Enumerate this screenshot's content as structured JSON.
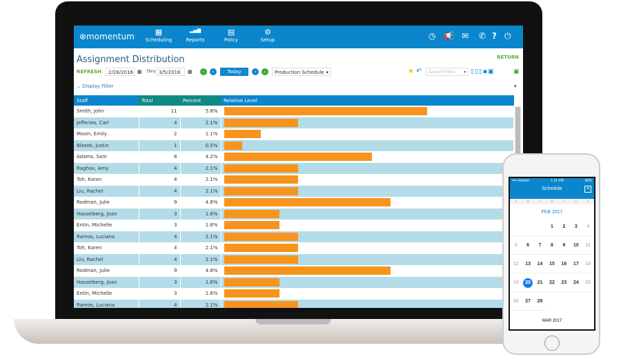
{
  "app": {
    "logo": "⊗momentum",
    "nav": [
      {
        "label": "Scheduling",
        "icon": "▦"
      },
      {
        "label": "Reports",
        "icon": "▂▄▆"
      },
      {
        "label": "Policy",
        "icon": "▤"
      },
      {
        "label": "Setup",
        "icon": "⚙"
      }
    ],
    "right_icons": [
      "clock-icon",
      "megaphone-icon",
      "mail-icon",
      "phone-icon",
      "help-icon",
      "power-icon"
    ]
  },
  "page": {
    "title": "Assignment Distribution",
    "return": "RETURN",
    "refresh": "REFRESH",
    "from": "2/28/2016",
    "thru": "thru",
    "to": "3/5/2016",
    "today": "Today",
    "schedule": "Production Schedule",
    "saved_filters": "Saved Filters",
    "display_filter": "Display Filter"
  },
  "table": {
    "headers": [
      "Staff",
      "Total",
      "Percent",
      "Relative Level"
    ],
    "rows": [
      [
        "Smith, John",
        11,
        "5.8%"
      ],
      [
        "Jefferies, Carl",
        4,
        "2.1%"
      ],
      [
        "Mosin, Emily",
        2,
        "1.1%"
      ],
      [
        "Blezek, Justin",
        1,
        "0.5%"
      ],
      [
        "Adams, Sam",
        8,
        "4.2%"
      ],
      [
        "Raghav, Amy",
        4,
        "2.1%"
      ],
      [
        "Toh, Karen",
        4,
        "2.1%"
      ],
      [
        "Liu, Rachel",
        4,
        "2.1%"
      ],
      [
        "Rodman, Julie",
        9,
        "4.8%"
      ],
      [
        "Hasselberg, Joan",
        3,
        "1.6%"
      ],
      [
        "Entin, Michelle",
        3,
        "1.6%"
      ],
      [
        "Ramos, Luciana",
        4,
        "2.1%"
      ],
      [
        "Toh, Karen",
        4,
        "2.1%"
      ],
      [
        "Liu, Rachel",
        4,
        "2.1%"
      ],
      [
        "Rodman, Julie",
        9,
        "4.8%"
      ],
      [
        "Hasselberg, Joan",
        3,
        "1.6%"
      ],
      [
        "Entin, Michelle",
        3,
        "1.6%"
      ],
      [
        "Ramos, Luciana",
        4,
        "2.1%"
      ]
    ]
  },
  "colors": {
    "nav": "#0b86cc",
    "header_staff": "#0b86cc",
    "header_teal": "#0e8a84",
    "bar": "#f7941d",
    "alt_row": "#b3dce8"
  },
  "phone": {
    "carrier": "•••• Verizon",
    "time": "1:21 PM",
    "battery": "82%",
    "title": "Schedule",
    "weekdays": [
      "S",
      "M",
      "T",
      "W",
      "T",
      "F",
      "S"
    ],
    "month": "FEB 2017",
    "next_month": "MAR 2017",
    "selected_day": 20
  }
}
